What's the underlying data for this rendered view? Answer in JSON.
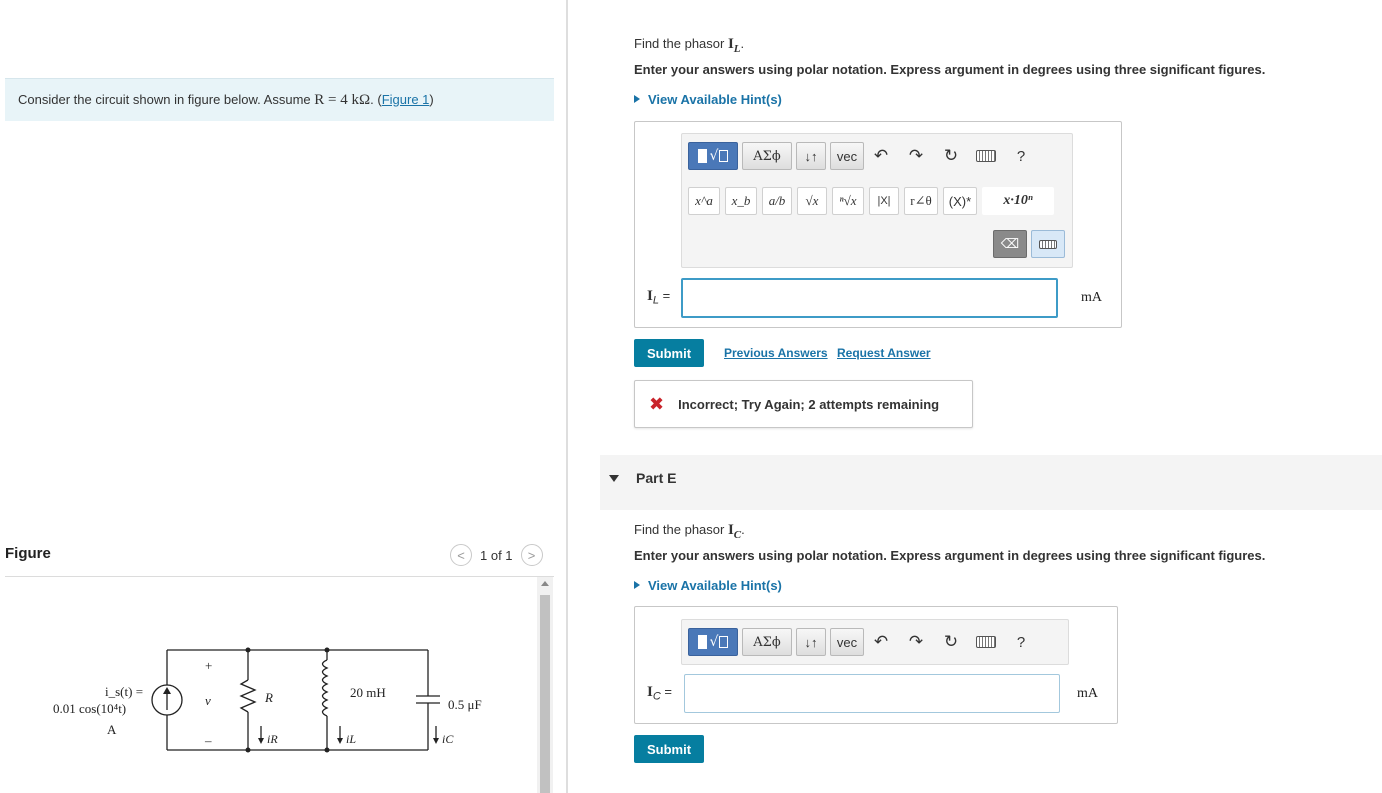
{
  "intro": {
    "text_before": "Consider the circuit shown in figure below. Assume ",
    "math": "R = 4 kΩ",
    "text_after": ". (",
    "figure_link": "Figure 1",
    "close_paren": ")"
  },
  "figure": {
    "label": "Figure",
    "counter": "1 of 1",
    "prev_symbol": "<",
    "next_symbol": ">"
  },
  "circuit": {
    "source_label_1": "i_s(t) =",
    "source_label_2": "0.01 cos(10⁴t)",
    "source_label_3": "A",
    "voltage_plus": "+",
    "voltage_label": "v",
    "voltage_minus": "–",
    "resistor_label": "R",
    "inductor_label": "20 mH",
    "capacitor_label": "0.5 μF",
    "current_R": "iR",
    "current_L": "iL",
    "current_C": "iC"
  },
  "partD": {
    "question_prefix": "Find the phasor ",
    "phasor_symbol": "I",
    "phasor_sub": "L",
    "question_suffix": ".",
    "instructions": "Enter your answers using polar notation. Express argument in degrees using three significant figures.",
    "hint": "View Available Hint(s)",
    "toolbar": {
      "row1": {
        "greek": "ΑΣϕ",
        "sort": "↓↑",
        "vec": "vec",
        "undo": "↶",
        "redo": "↷",
        "reset": "↻",
        "help": "?"
      },
      "row2": [
        "x^a",
        "x_b",
        "a/b",
        "√x",
        "ⁿ√x",
        "|X|",
        "r∠θ",
        "(X)*",
        "x·10ⁿ"
      ],
      "backspace": "⌫"
    },
    "answer_label_sym": "I",
    "answer_label_sub": "L",
    "answer_label_eq": " =",
    "answer_value": "",
    "unit": "mA",
    "submit": "Submit",
    "previous_answers": "Previous Answers",
    "request_answer": "Request Answer",
    "feedback_icon": "✖",
    "feedback": "Incorrect; Try Again; 2 attempts remaining"
  },
  "partE": {
    "title": "Part E",
    "question_prefix": "Find the phasor ",
    "phasor_symbol": "I",
    "phasor_sub": "C",
    "question_suffix": ".",
    "instructions": "Enter your answers using polar notation. Express argument in degrees using three significant figures.",
    "hint": "View Available Hint(s)",
    "toolbar": {
      "greek": "ΑΣϕ",
      "sort": "↓↑",
      "vec": "vec",
      "undo": "↶",
      "redo": "↷",
      "reset": "↻",
      "help": "?"
    },
    "answer_label_sym": "I",
    "answer_label_sub": "C",
    "answer_label_eq": " =",
    "answer_value": "",
    "unit": "mA",
    "submit": "Submit"
  },
  "colors": {
    "accent": "#067ea0",
    "link": "#1a73a7",
    "error": "#c9242b",
    "intro_bg": "#e8f4f8"
  }
}
